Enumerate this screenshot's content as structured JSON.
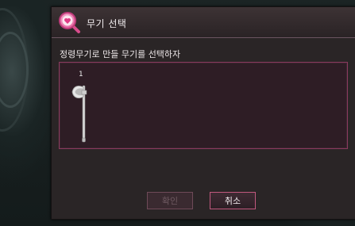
{
  "dialog": {
    "title": "무기 선택",
    "title_icon": "magnifier-heart-icon",
    "instruction": "정령무기로 만들 무기를 선택하자",
    "accent_color": "#c0587e",
    "items": [
      {
        "icon": "battle-axe-icon",
        "count": "1"
      }
    ],
    "buttons": {
      "confirm_label": "확인",
      "confirm_enabled": false,
      "cancel_label": "취소",
      "cancel_enabled": true
    }
  }
}
